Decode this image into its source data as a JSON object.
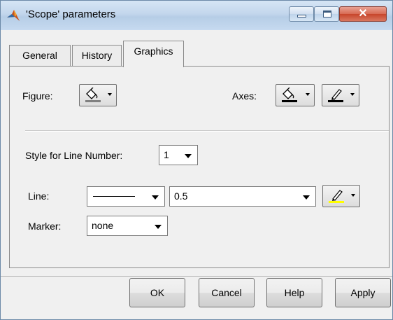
{
  "window": {
    "title": "'Scope' parameters",
    "close_glyph": "✕",
    "accent_color": "#c7452b"
  },
  "tabs": [
    {
      "label": "General",
      "active": false
    },
    {
      "label": "History",
      "active": false
    },
    {
      "label": "Graphics",
      "active": true
    }
  ],
  "figure": {
    "label": "Figure:",
    "icon": "paint-bucket-icon"
  },
  "axes": {
    "label": "Axes:",
    "icons": [
      "paint-bucket-icon",
      "pen-color-icon"
    ]
  },
  "style_line": {
    "label": "Style for Line Number:",
    "value": "1"
  },
  "line": {
    "label": "Line:",
    "style_value": "solid",
    "width_value": "0.5",
    "color_icon": "pen-color-icon",
    "color": "#ffff00"
  },
  "marker": {
    "label": "Marker:",
    "value": "none"
  },
  "buttons": {
    "ok": "OK",
    "cancel": "Cancel",
    "help": "Help",
    "apply": "Apply"
  }
}
